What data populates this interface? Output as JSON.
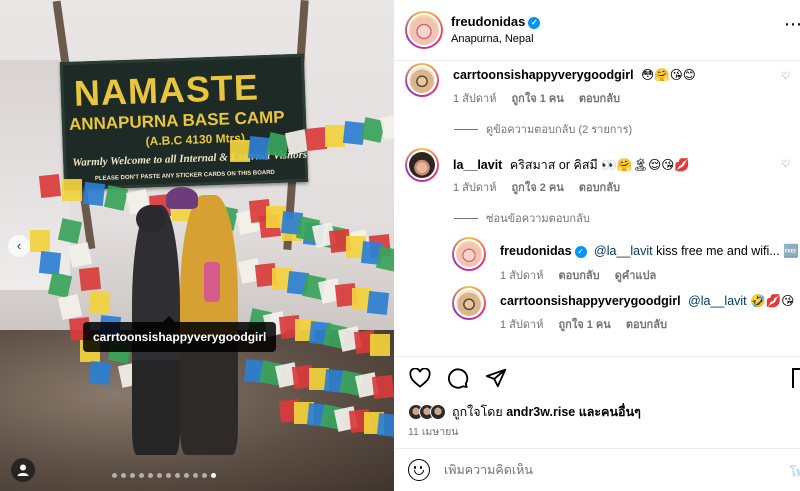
{
  "photo": {
    "sign": {
      "line1": "NAMASTE",
      "line2": "ANNAPURNA BASE CAMP",
      "line3": "(A.B.C 4130 Mtrs)",
      "line4": "Warmly Welcome to all Internal & External Visitors",
      "line5": "PLEASE DON'T PASTE ANY STICKER CARDS ON THIS BOARD"
    },
    "tagged_user": "carrtoonsishappyverygoodgirl",
    "carousel_dots": 12,
    "carousel_active": 11
  },
  "post": {
    "author": "freudonidas",
    "location": "Anapurna, Nepal",
    "more_icon": "more-icon",
    "comments": [
      {
        "user": "carrtoonsishappyverygoodgirl",
        "text": "😳🤗😘😊",
        "time": "1 สัปดาห์",
        "likes": "",
        "reply": "ตอบกลับ"
      },
      {
        "user": "la__lavit",
        "text": "คริสมาส or คิสมี 👀🤗🏝😌😘💋",
        "time": "1 สัปดาห์",
        "likes": "ถูกใจ 2 คน",
        "reply": "ตอบกลับ"
      }
    ],
    "first_comment_likes": "ถูกใจ 1 คน",
    "view_replies": "ดูข้อความตอบกลับ (2 รายการ)",
    "hide_replies": "ซ่อนข้อความตอบกลับ",
    "replies": [
      {
        "user": "freudonidas",
        "mention": "@la__lavit",
        "text": "kiss free me and wifi... 🆓",
        "time": "1 สัปดาห์",
        "reply": "ตอบกลับ",
        "translate": "ดูคำแปล"
      },
      {
        "user": "carrtoonsishappyverygoodgirl",
        "mention": "@la__lavit",
        "text": "🤣💋😘",
        "time": "1 สัปดาห์",
        "likes": "ถูกใจ 1 คน",
        "reply": "ตอบกลับ"
      }
    ],
    "liked_by_prefix": "ถูกใจโดย",
    "liked_by_user": "andr3w.rise",
    "liked_by_suffix": "และคนอื่นๆ",
    "date": "11 เมษายน",
    "comment_placeholder": "เพิ่มความคิดเห็น",
    "post_button": "โพ"
  }
}
